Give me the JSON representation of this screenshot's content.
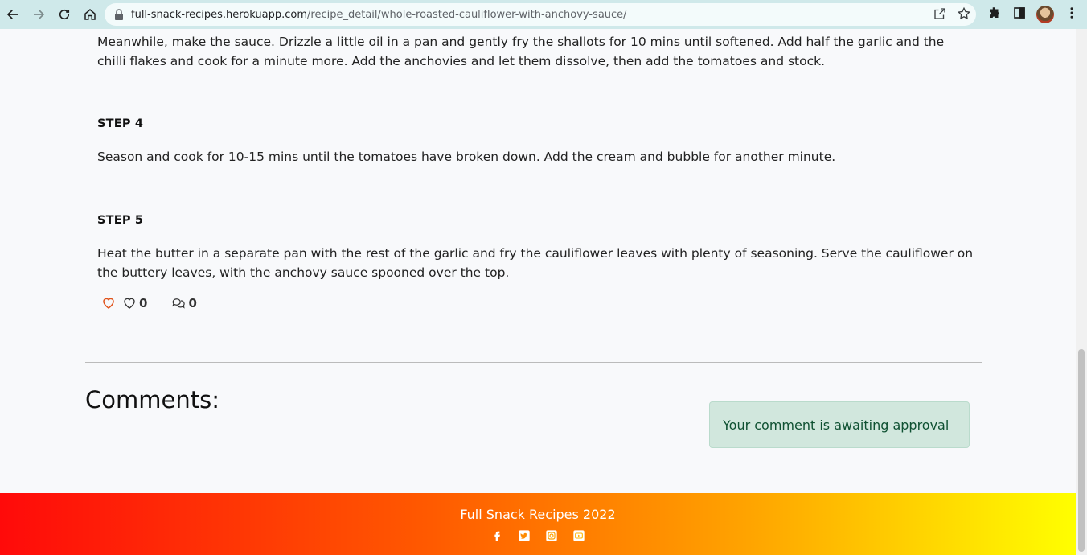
{
  "browser": {
    "url_host": "full-snack-recipes.herokuapp.com",
    "url_path": "/recipe_detail/whole-roasted-cauliflower-with-anchovy-sauce/"
  },
  "recipe": {
    "step3_text": "Meanwhile, make the sauce. Drizzle a little oil in a pan and gently fry the shallots for 10 mins until softened. Add half the garlic and the chilli flakes and cook for a minute more. Add the anchovies and let them dissolve, then add the tomatoes and stock.",
    "step4_title": "STEP 4",
    "step4_text": "Season and cook for 10-15 mins until the tomatoes have broken down. Add the cream and bubble for another minute.",
    "step5_title": "STEP 5",
    "step5_text": "Heat the butter in a separate pan with the rest of the garlic and fry the cauliflower leaves with plenty of seasoning. Serve the cauliflower on the buttery leaves, with the anchovy sauce spooned over the top.",
    "likes": "0",
    "comments_count": "0"
  },
  "comments": {
    "heading": "Comments:",
    "pending_message": "Your comment is awaiting approval"
  },
  "footer": {
    "text": "Full Snack Recipes 2022",
    "socials": [
      "facebook-icon",
      "twitter-icon",
      "instagram-icon",
      "youtube-icon"
    ]
  },
  "colors": {
    "like_accent": "#e0531b",
    "alert_bg": "#d1e7dd",
    "footer_gradient_start": "#ff0a0a",
    "footer_gradient_end": "#ffff00"
  }
}
